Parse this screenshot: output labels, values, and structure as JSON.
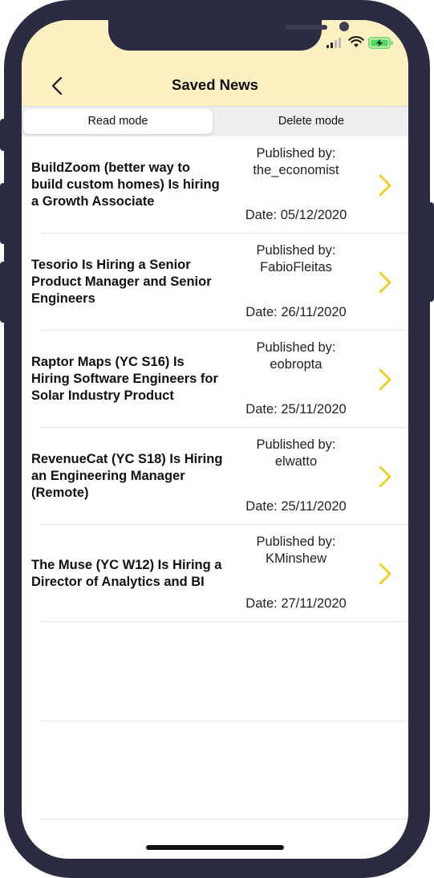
{
  "header": {
    "title": "Saved News"
  },
  "icons": {
    "back": "chevron-left-icon",
    "row_arrow": "chevron-right-icon"
  },
  "colors": {
    "header_bg": "#fdf0c1",
    "accent": "#f7c90a",
    "battery": "#4cd964"
  },
  "tabs": [
    {
      "label": "Read mode",
      "selected": true
    },
    {
      "label": "Delete mode",
      "selected": false
    }
  ],
  "news": [
    {
      "title": "BuildZoom (better way to build custom homes) Is hiring a Growth Associate",
      "published_label": "Published by:",
      "author": "the_economist",
      "date": "Date: 05/12/2020"
    },
    {
      "title": "Tesorio Is Hiring a Senior Product Manager and Senior Engineers",
      "published_label": "Published by:",
      "author": "FabioFleitas",
      "date": "Date: 26/11/2020"
    },
    {
      "title": "Raptor Maps (YC S16) Is Hiring Software Engineers for Solar Industry Product",
      "published_label": "Published by:",
      "author": "eobropta",
      "date": "Date: 25/11/2020"
    },
    {
      "title": "RevenueCat (YC S18) Is Hiring an Engineering Manager (Remote)",
      "published_label": "Published by:",
      "author": "elwatto",
      "date": "Date: 25/11/2020"
    },
    {
      "title": "The Muse (YC W12) Is Hiring a Director of Analytics and BI",
      "published_label": "Published by:",
      "author": "KMinshew",
      "date": "Date: 27/11/2020"
    }
  ]
}
